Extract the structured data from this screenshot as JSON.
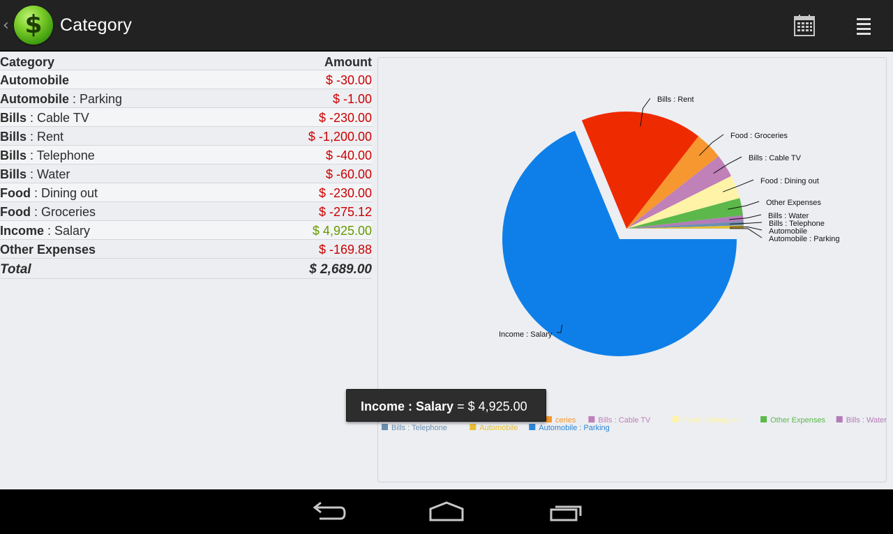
{
  "actionbar": {
    "up_caret": "‹",
    "app_icon": "dollar-icon",
    "app_icon_glyph": "$",
    "title": "Category",
    "calendar_icon": "calendar-icon",
    "menu_icon": "overflow-menu-icon"
  },
  "table": {
    "headers": {
      "category": "Category",
      "amount": "Amount"
    },
    "rows": [
      {
        "parent": "Automobile",
        "child": "",
        "amount": "$ -30.00",
        "sign": "neg"
      },
      {
        "parent": "Automobile",
        "child": " : Parking",
        "amount": "$ -1.00",
        "sign": "neg"
      },
      {
        "parent": "Bills",
        "child": " : Cable TV",
        "amount": "$ -230.00",
        "sign": "neg"
      },
      {
        "parent": "Bills",
        "child": " : Rent",
        "amount": "$ -1,200.00",
        "sign": "neg"
      },
      {
        "parent": "Bills",
        "child": " : Telephone",
        "amount": "$ -40.00",
        "sign": "neg"
      },
      {
        "parent": "Bills",
        "child": " : Water",
        "amount": "$ -60.00",
        "sign": "neg"
      },
      {
        "parent": "Food",
        "child": " : Dining out",
        "amount": "$ -230.00",
        "sign": "neg"
      },
      {
        "parent": "Food",
        "child": " : Groceries",
        "amount": "$ -275.12",
        "sign": "neg"
      },
      {
        "parent": "Income",
        "child": " : Salary",
        "amount": "$ 4,925.00",
        "sign": "pos"
      },
      {
        "parent": "Other Expenses",
        "child": "",
        "amount": "$ -169.88",
        "sign": "neg"
      }
    ],
    "total": {
      "label": "Total",
      "amount": "$ 2,689.00"
    }
  },
  "chart_data": {
    "type": "pie",
    "slices": [
      {
        "label": "Income : Salary",
        "value": 4925.0,
        "color": "#0e7fe8",
        "exploded": true
      },
      {
        "label": "Bills : Rent",
        "value": 1200.0,
        "color": "#ee2a00"
      },
      {
        "label": "Food : Groceries",
        "value": 275.12,
        "color": "#f7972f"
      },
      {
        "label": "Bills : Cable TV",
        "value": 230.0,
        "color": "#c080b8"
      },
      {
        "label": "Food : Dining out",
        "value": 230.0,
        "color": "#fff3a8"
      },
      {
        "label": "Other Expenses",
        "value": 169.88,
        "color": "#5cb84a"
      },
      {
        "label": "Bills : Water",
        "value": 60.0,
        "color": "#b27cb8"
      },
      {
        "label": "Bills : Telephone",
        "value": 40.0,
        "color": "#6a8fb0"
      },
      {
        "label": "Automobile",
        "value": 30.0,
        "color": "#e8c030"
      },
      {
        "label": "Automobile : Parking",
        "value": 1.0,
        "color": "#2c86d6"
      }
    ],
    "legend": {
      "placement": "bottom",
      "row1": [
        {
          "label": "ceries",
          "color": "#f7972f"
        },
        {
          "label": "Bills : Cable TV",
          "color": "#c080b8"
        },
        {
          "label": "Food : Dining out",
          "color": "#fff3a8"
        },
        {
          "label": "Other Expenses",
          "color": "#5cb84a"
        },
        {
          "label": "Bills : Water",
          "color": "#b27cb8"
        }
      ],
      "row2": [
        {
          "label": "Bills : Telephone",
          "color": "#6a8fb0"
        },
        {
          "label": "Automobile",
          "color": "#e8c030"
        },
        {
          "label": "Automobile : Parking",
          "color": "#2c86d6"
        }
      ]
    }
  },
  "toast": {
    "label": "Income : Salary",
    "equals": " = ",
    "value": "$ 4,925.00"
  },
  "navbar": {
    "back": "back-icon",
    "home": "home-icon",
    "recents": "recents-icon"
  }
}
